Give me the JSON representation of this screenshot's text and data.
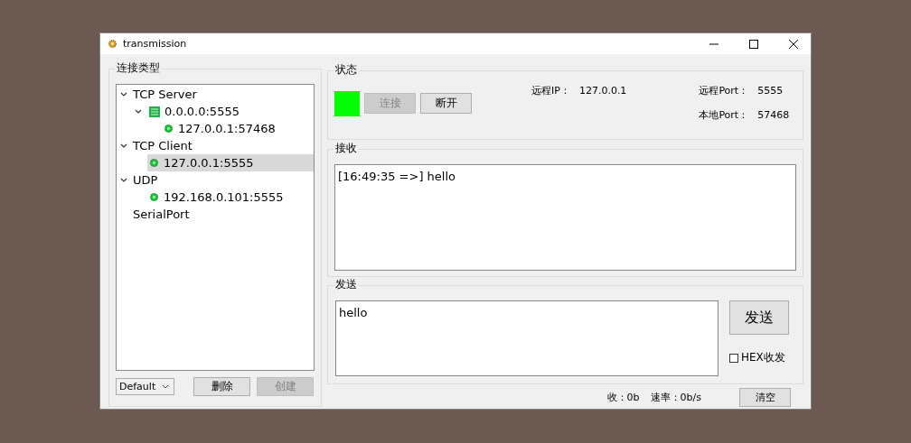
{
  "window": {
    "title": "transmission"
  },
  "sidebar": {
    "title": "连接类型",
    "tree": [
      {
        "label": "TCP Server",
        "kind": "category",
        "expanded": true,
        "selected": false,
        "children": [
          {
            "label": "0.0.0.0:5555",
            "kind": "server",
            "expanded": true,
            "selected": false,
            "children": [
              {
                "label": "127.0.0.1:57468",
                "kind": "connection",
                "selected": false
              }
            ]
          }
        ]
      },
      {
        "label": "TCP Client",
        "kind": "category",
        "expanded": true,
        "selected": false,
        "children": [
          {
            "label": "127.0.0.1:5555",
            "kind": "connection",
            "selected": true
          }
        ]
      },
      {
        "label": "UDP",
        "kind": "category",
        "expanded": true,
        "selected": false,
        "children": [
          {
            "label": "192.168.0.101:5555",
            "kind": "connection",
            "selected": false
          }
        ]
      },
      {
        "label": "SerialPort",
        "kind": "category",
        "selected": false
      }
    ],
    "mode_select": {
      "value": "Default"
    },
    "buttons": [
      {
        "label": "删除",
        "disabled": false
      },
      {
        "label": "创建",
        "disabled": true
      }
    ]
  },
  "status": {
    "title": "状态",
    "connected": true,
    "buttons": [
      {
        "label": "连接",
        "disabled": true
      },
      {
        "label": "断开",
        "disabled": false
      }
    ],
    "info_left": [
      {
        "label": "远程IP：",
        "value": "127.0.0.1"
      }
    ],
    "info_right": [
      {
        "label": "远程Port：",
        "value": "5555"
      },
      {
        "label": "本地Port：",
        "value": "57468"
      }
    ]
  },
  "receive": {
    "title": "接收",
    "text": "[16:49:35 =>] hello"
  },
  "send": {
    "title": "发送",
    "value": "hello",
    "send_button": "发送",
    "hex": {
      "label": "HEX收发",
      "checked": false
    }
  },
  "footer": {
    "received": "收：0b",
    "rate": "速率：0b/s",
    "clear_button": "清空"
  }
}
